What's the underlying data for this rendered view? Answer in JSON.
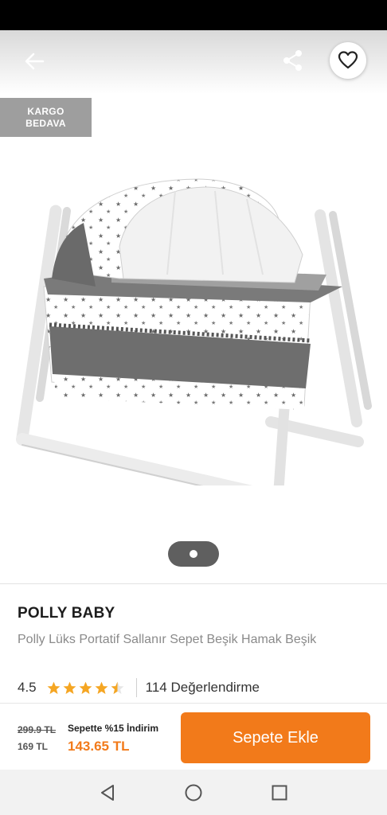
{
  "badge": {
    "line1": "KARGO",
    "line2": "BEDAVA"
  },
  "product": {
    "brand": "POLLY BABY",
    "title": "Polly Lüks Portatif Sallanır Sepet Beşik Hamak Beşik",
    "rating": "4.5",
    "rating_stars": 4.5,
    "review_count": "114 Değerlendirme"
  },
  "pricing": {
    "old_price": "299.9 TL",
    "price": "169 TL",
    "campaign_label": "Sepette %15 İndirim",
    "campaign_price": "143.65 TL"
  },
  "actions": {
    "add_to_cart": "Sepete Ekle"
  },
  "gallery": {
    "current_page": 1,
    "total_pages": 1
  },
  "icons": {
    "back": "arrow-left-icon",
    "share": "share-icon",
    "favorite": "heart-outline-icon",
    "star": "star-icon"
  },
  "colors": {
    "accent": "#f27a1a",
    "star": "#f5a623",
    "badge_bg": "#9e9e9e"
  }
}
